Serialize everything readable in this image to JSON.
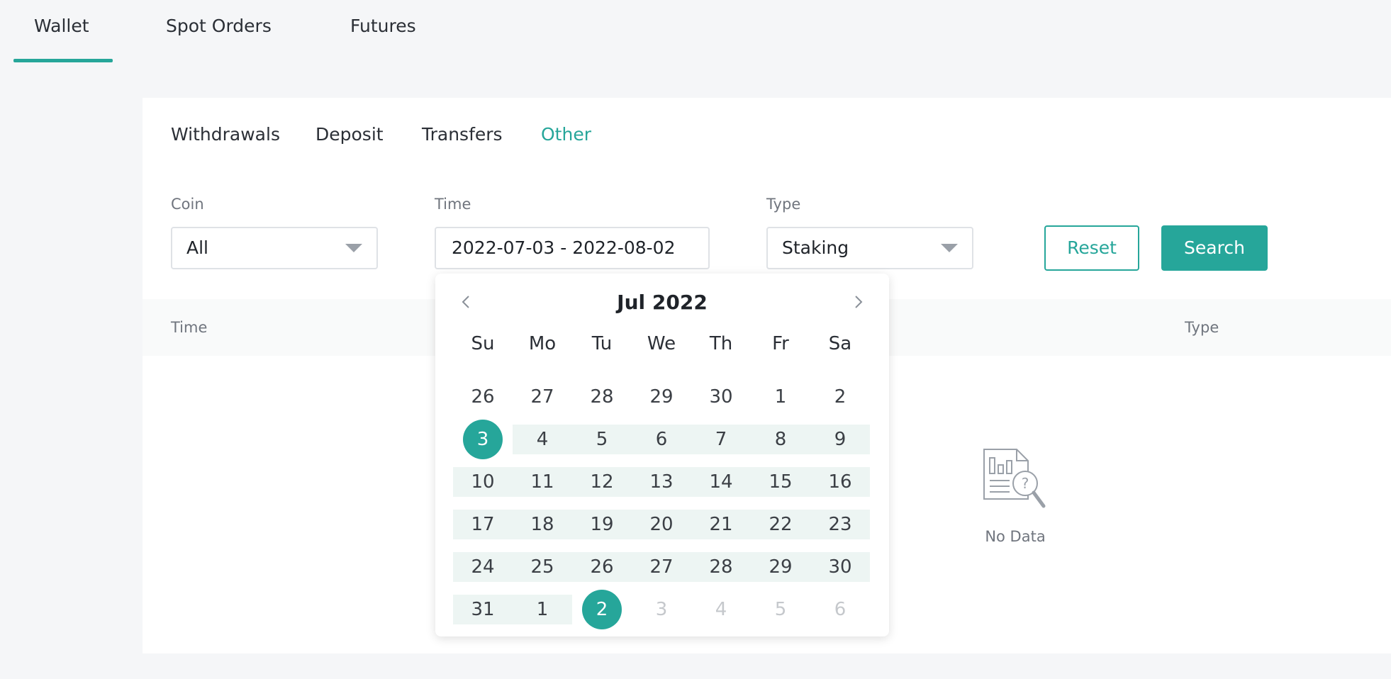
{
  "top_tabs": [
    "Wallet",
    "Spot Orders",
    "Futures"
  ],
  "sub_tabs": [
    "Withdrawals",
    "Deposit",
    "Transfers",
    "Other"
  ],
  "filters": {
    "coin_label": "Coin",
    "coin_value": "All",
    "time_label": "Time",
    "time_value": "2022-07-03 - 2022-08-02",
    "type_label": "Type",
    "type_value": "Staking",
    "reset_label": "Reset",
    "search_label": "Search"
  },
  "table": {
    "col_time": "Time",
    "col_type": "Type",
    "empty_text": "No Data"
  },
  "calendar": {
    "month_title": "Jul 2022",
    "weekdays": [
      "Su",
      "Mo",
      "Tu",
      "We",
      "Th",
      "Fr",
      "Sa"
    ],
    "weeks": [
      [
        "26",
        "27",
        "28",
        "29",
        "30",
        "1",
        "2"
      ],
      [
        "3",
        "4",
        "5",
        "6",
        "7",
        "8",
        "9"
      ],
      [
        "10",
        "11",
        "12",
        "13",
        "14",
        "15",
        "16"
      ],
      [
        "17",
        "18",
        "19",
        "20",
        "21",
        "22",
        "23"
      ],
      [
        "24",
        "25",
        "26",
        "27",
        "28",
        "29",
        "30"
      ],
      [
        "31",
        "1",
        "2",
        "3",
        "4",
        "5",
        "6"
      ]
    ],
    "range_start": "2022-07-03",
    "range_end": "2022-08-02"
  },
  "colors": {
    "accent": "#26a69a",
    "range_bg": "#edf5f3"
  }
}
